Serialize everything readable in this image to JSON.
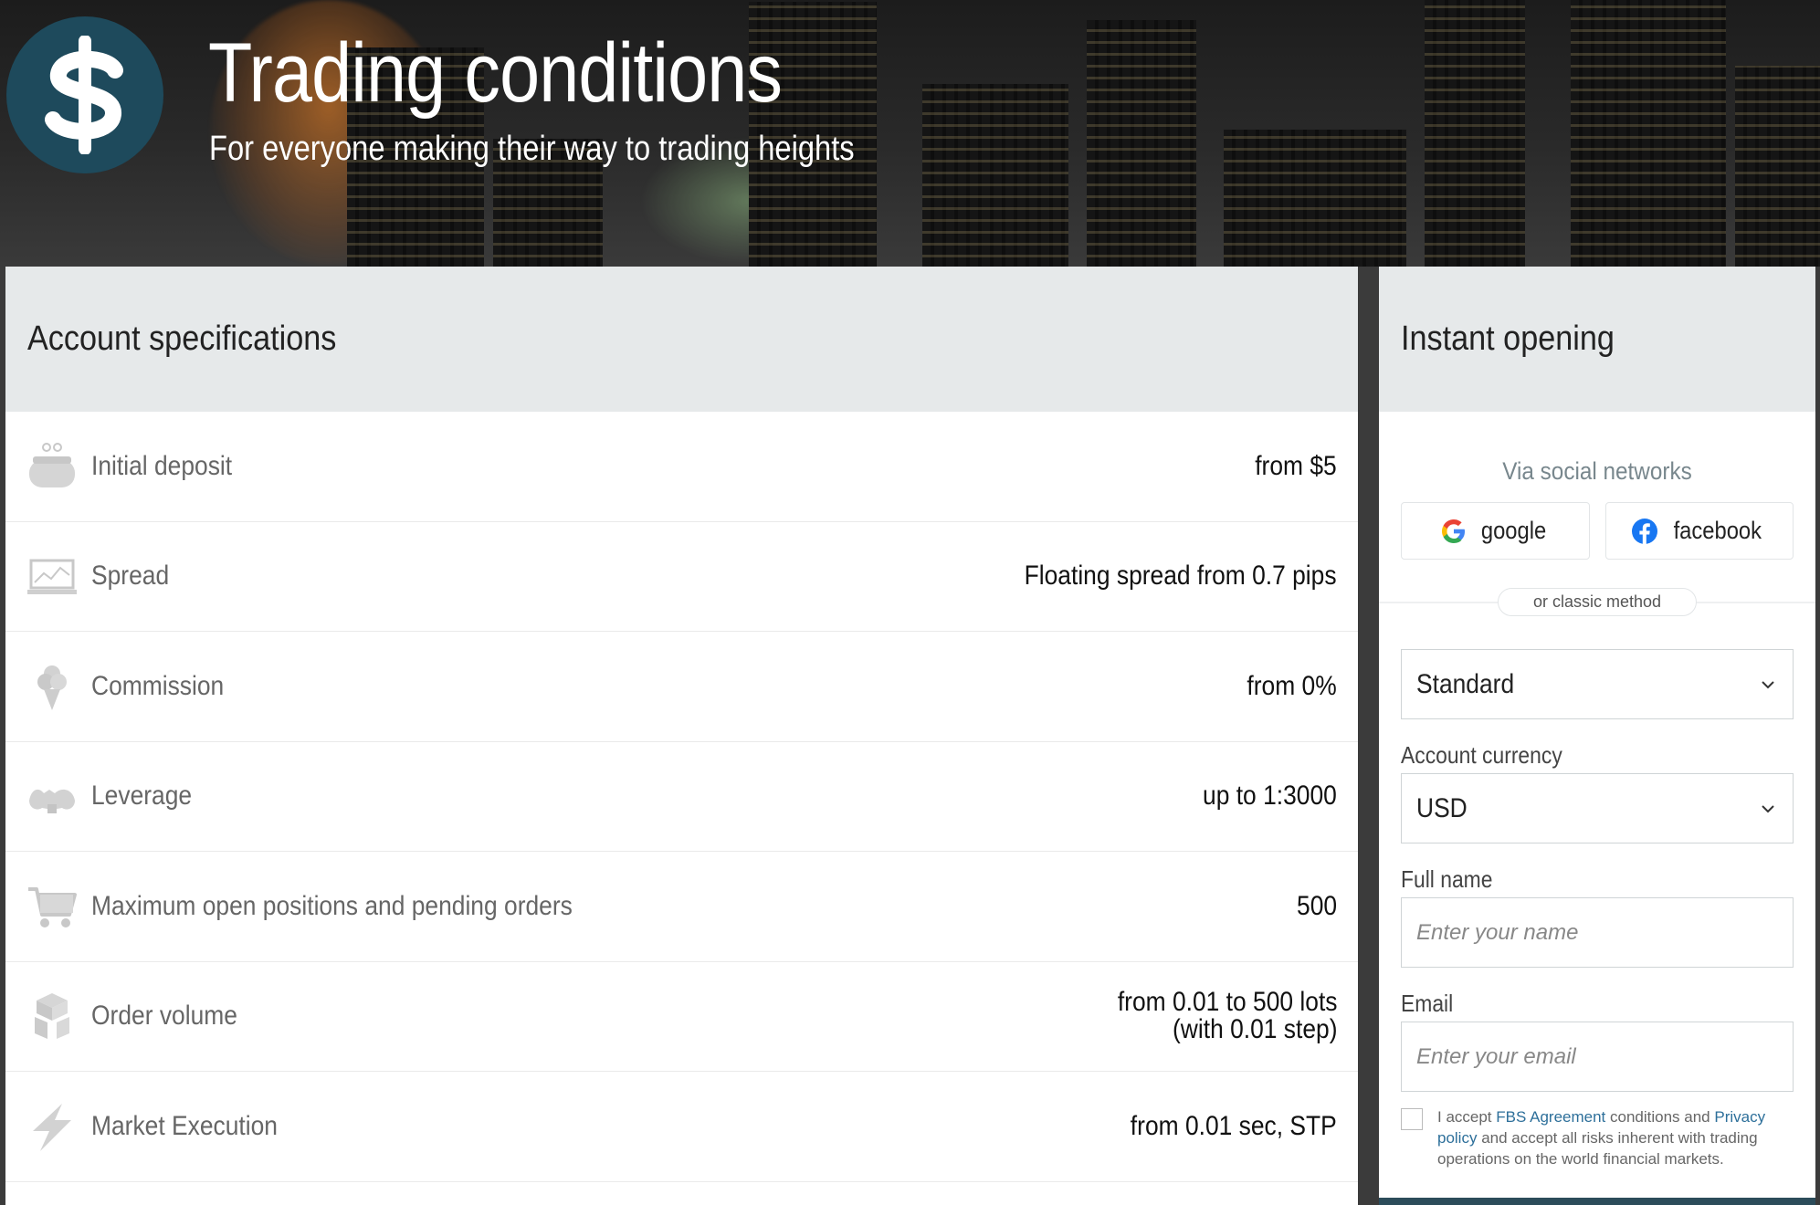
{
  "hero": {
    "title": "Trading conditions",
    "subtitle": "For everyone making their way to trading heights",
    "logo_icon": "dollar-icon"
  },
  "specs": {
    "heading": "Account specifications",
    "rows": [
      {
        "icon": "wallet-icon",
        "label": "Initial deposit",
        "value": "from $5"
      },
      {
        "icon": "chart-monitor-icon",
        "label": "Spread",
        "value": "Floating spread from 0.7 pips"
      },
      {
        "icon": "ice-cream-icon",
        "label": "Commission",
        "value": "from 0%"
      },
      {
        "icon": "muscle-arm-icon",
        "label": "Leverage",
        "value": "up to 1:3000"
      },
      {
        "icon": "shopping-cart-icon",
        "label": "Maximum open positions and pending orders",
        "value": "500"
      },
      {
        "icon": "boxes-icon",
        "label": "Order volume",
        "value_line1": "from 0.01 to 500 lots",
        "value_line2": "(with 0.01 step)"
      },
      {
        "icon": "lightning-icon",
        "label": "Market Execution",
        "value": "from 0.01 sec, STP"
      }
    ]
  },
  "open": {
    "heading": "Instant opening",
    "via_social": "Via social networks",
    "google_label": "google",
    "facebook_label": "facebook",
    "divider_label": "or classic method",
    "account_type": "Standard",
    "currency_label": "Account currency",
    "currency_value": "USD",
    "fullname_label": "Full name",
    "fullname_placeholder": "Enter your name",
    "email_label": "Email",
    "email_placeholder": "Enter your email",
    "accept": {
      "prefix": "I accept ",
      "agreement_link": "FBS Agreement",
      "middle": " conditions and ",
      "privacy_link": "Privacy policy",
      "suffix": " and accept all risks inherent with trading operations on the world financial markets."
    }
  },
  "colors": {
    "logo_bg": "#1e4a5c",
    "panel_head_bg": "#e6e9ea",
    "link": "#2d6f9a",
    "bottom_bar": "#2c4c5a"
  }
}
